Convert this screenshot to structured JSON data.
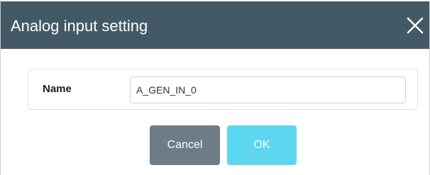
{
  "dialog": {
    "title": "Analog input setting",
    "close_icon": "close-icon",
    "colors": {
      "titlebar": "#435a66",
      "cancel_button": "#6e7c87",
      "ok_button": "#5dd6ef"
    }
  },
  "form": {
    "name_label": "Name",
    "name_value": "A_GEN_IN_0"
  },
  "buttons": {
    "cancel_label": "Cancel",
    "ok_label": "OK"
  }
}
